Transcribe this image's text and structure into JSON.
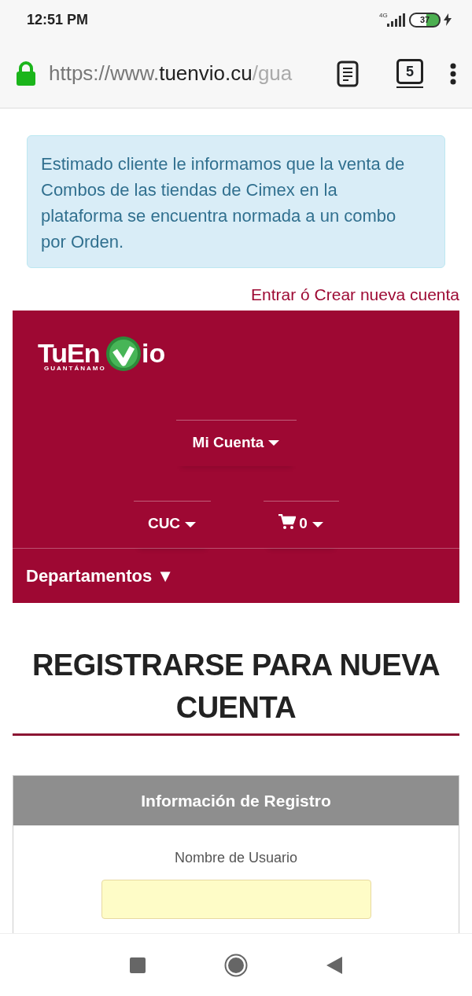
{
  "status_bar": {
    "time": "12:51 PM",
    "network": "4G",
    "battery": "37",
    "charging": true
  },
  "browser": {
    "url_scheme": "https://www.",
    "url_host": "tuenvio.cu",
    "url_path": "/gua",
    "secure": true,
    "tab_count": "5"
  },
  "notice": "Estimado cliente le informamos que la venta de Combos de las tiendas de Cimex en la plataforma se encuentra normada a un combo por Orden.",
  "account_link": "Entrar ó Crear nueva cuenta",
  "header": {
    "logo": {
      "left": "TuEn",
      "right": "io",
      "subtitle": "GUANTÁNAMO"
    },
    "menus": [
      {
        "kind": "account",
        "label": "Mi Cuenta"
      },
      {
        "kind": "currency",
        "label": "CUC"
      },
      {
        "kind": "cart",
        "label": "0"
      }
    ],
    "departments": "Departamentos ▼"
  },
  "heading": "REGISTRARSE PARA NUEVA CUENTA",
  "panel": {
    "title": "Información de Registro",
    "fields": [
      {
        "label": "Nombre de Usuario"
      }
    ]
  }
}
